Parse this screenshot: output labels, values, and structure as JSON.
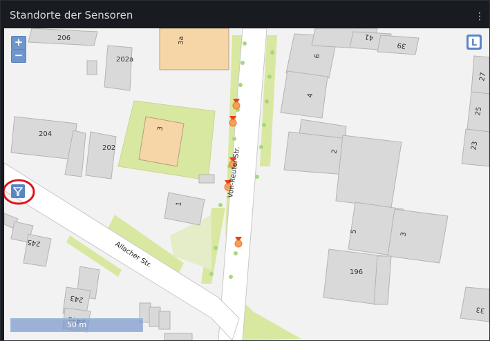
{
  "panel": {
    "title": "Standorte der Sensoren",
    "menu_icon": "vertical-ellipsis-icon"
  },
  "map_controls": {
    "zoom_in": "+",
    "zoom_out": "−",
    "layer_switch": "L",
    "scale": "50 m",
    "filter_icon": "funnel-filter-icon",
    "highlight_color": "#e1131b"
  },
  "streets": {
    "von_reuter": "Von-Reuter-Str.",
    "allacher": "Allacher Str."
  },
  "house_numbers": [
    "206",
    "3a",
    "202a",
    "204",
    "202",
    "3",
    "1",
    "245",
    "243",
    "243a",
    "6",
    "4",
    "2",
    "41",
    "39",
    "27",
    "25",
    "23",
    "5",
    "3",
    "196",
    "33"
  ],
  "sensor_count": 5,
  "colors": {
    "marker": "#f28b30",
    "building": "#d9d9d9",
    "school": "#f6d6a6",
    "green": "#d9e8a0"
  }
}
